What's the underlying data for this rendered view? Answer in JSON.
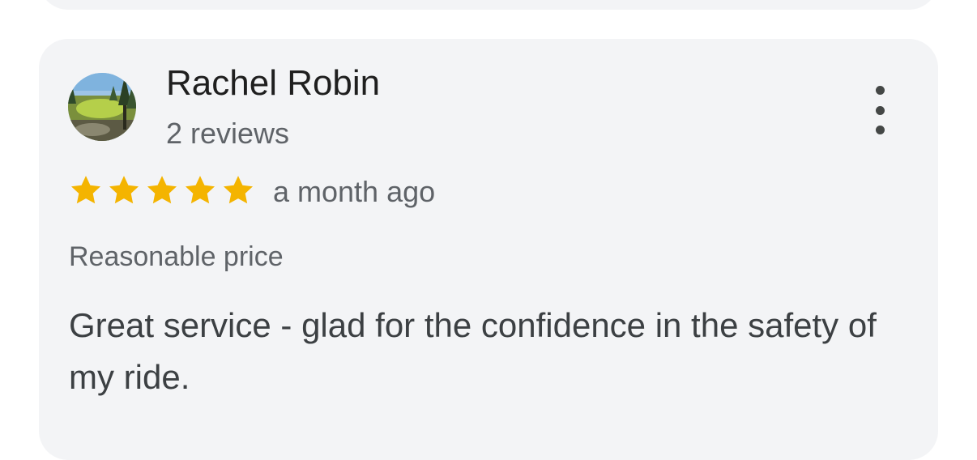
{
  "review": {
    "author_name": "Rachel Robin",
    "author_review_count": "2 reviews",
    "rating": 5,
    "rating_max": 5,
    "time_ago": "a month ago",
    "tag": "Reasonable price",
    "text": "Great service - glad for the confidence in the safety of my ride."
  },
  "icons": {
    "menu": "more-vert-icon",
    "star": "star-icon",
    "avatar": "landscape-photo-avatar"
  },
  "colors": {
    "star": "#f4b400",
    "card_bg": "#f3f4f6"
  }
}
